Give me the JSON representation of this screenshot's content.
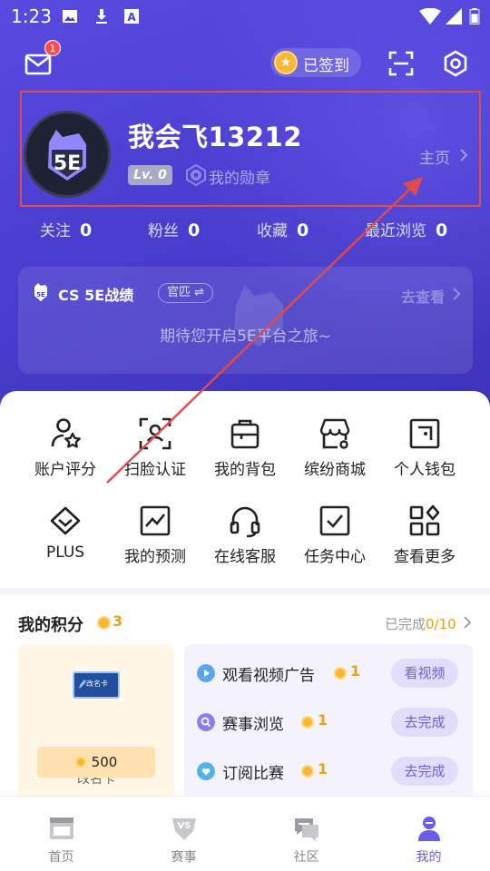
{
  "status_bar": {
    "time": "1:23",
    "icons": [
      "image-icon",
      "download-icon",
      "a-icon",
      "wifi-icon",
      "signal-icon",
      "battery-icon"
    ]
  },
  "header": {
    "mail_badge": "1",
    "signin_label": "已签到"
  },
  "profile": {
    "username": "我会飞13212",
    "level": "Lv. 0",
    "medal_label": "我的勋章",
    "home_link": "主页"
  },
  "stats": [
    {
      "label": "关注",
      "value": "0"
    },
    {
      "label": "粉丝",
      "value": "0"
    },
    {
      "label": "收藏",
      "value": "0"
    },
    {
      "label": "最近浏览",
      "value": "0"
    }
  ],
  "cs_card": {
    "title": "CS 5E战绩",
    "tag": "官匹 ⇌",
    "action": "去查看",
    "message": "期待您开启5E平台之旅~"
  },
  "grid": [
    {
      "label": "账户评分",
      "icon": "account-rating-icon"
    },
    {
      "label": "扫脸认证",
      "icon": "face-scan-icon"
    },
    {
      "label": "我的背包",
      "icon": "backpack-icon"
    },
    {
      "label": "缤纷商城",
      "icon": "store-icon"
    },
    {
      "label": "个人钱包",
      "icon": "wallet-icon"
    },
    {
      "label": "PLUS",
      "icon": "plus-diamond-icon"
    },
    {
      "label": "我的预测",
      "icon": "prediction-icon"
    },
    {
      "label": "在线客服",
      "icon": "headset-icon"
    },
    {
      "label": "任务中心",
      "icon": "task-check-icon"
    },
    {
      "label": "查看更多",
      "icon": "more-grid-icon"
    }
  ],
  "points": {
    "title": "我的积分",
    "value": "3",
    "done_label": "已完成",
    "done_value": "0/10",
    "rename_card": {
      "card_text": "改名卡",
      "label": "改名卡",
      "price": "500"
    },
    "tasks": [
      {
        "name": "观看视频广告",
        "reward": "1",
        "button": "看视频",
        "icon": "play-icon"
      },
      {
        "name": "赛事浏览",
        "reward": "1",
        "button": "去完成",
        "icon": "search-icon"
      },
      {
        "name": "订阅比赛",
        "reward": "1",
        "button": "去完成",
        "icon": "heart-icon"
      }
    ]
  },
  "tabs": [
    {
      "label": "首页",
      "icon": "home-icon"
    },
    {
      "label": "赛事",
      "icon": "vs-icon"
    },
    {
      "label": "社区",
      "icon": "chat-icon"
    },
    {
      "label": "我的",
      "icon": "user-icon",
      "active": true
    }
  ],
  "colors": {
    "hero": "#4b3fd2",
    "accent": "#6a5ee8",
    "coin": "#f6b735",
    "annotation": "#e14b4b"
  }
}
